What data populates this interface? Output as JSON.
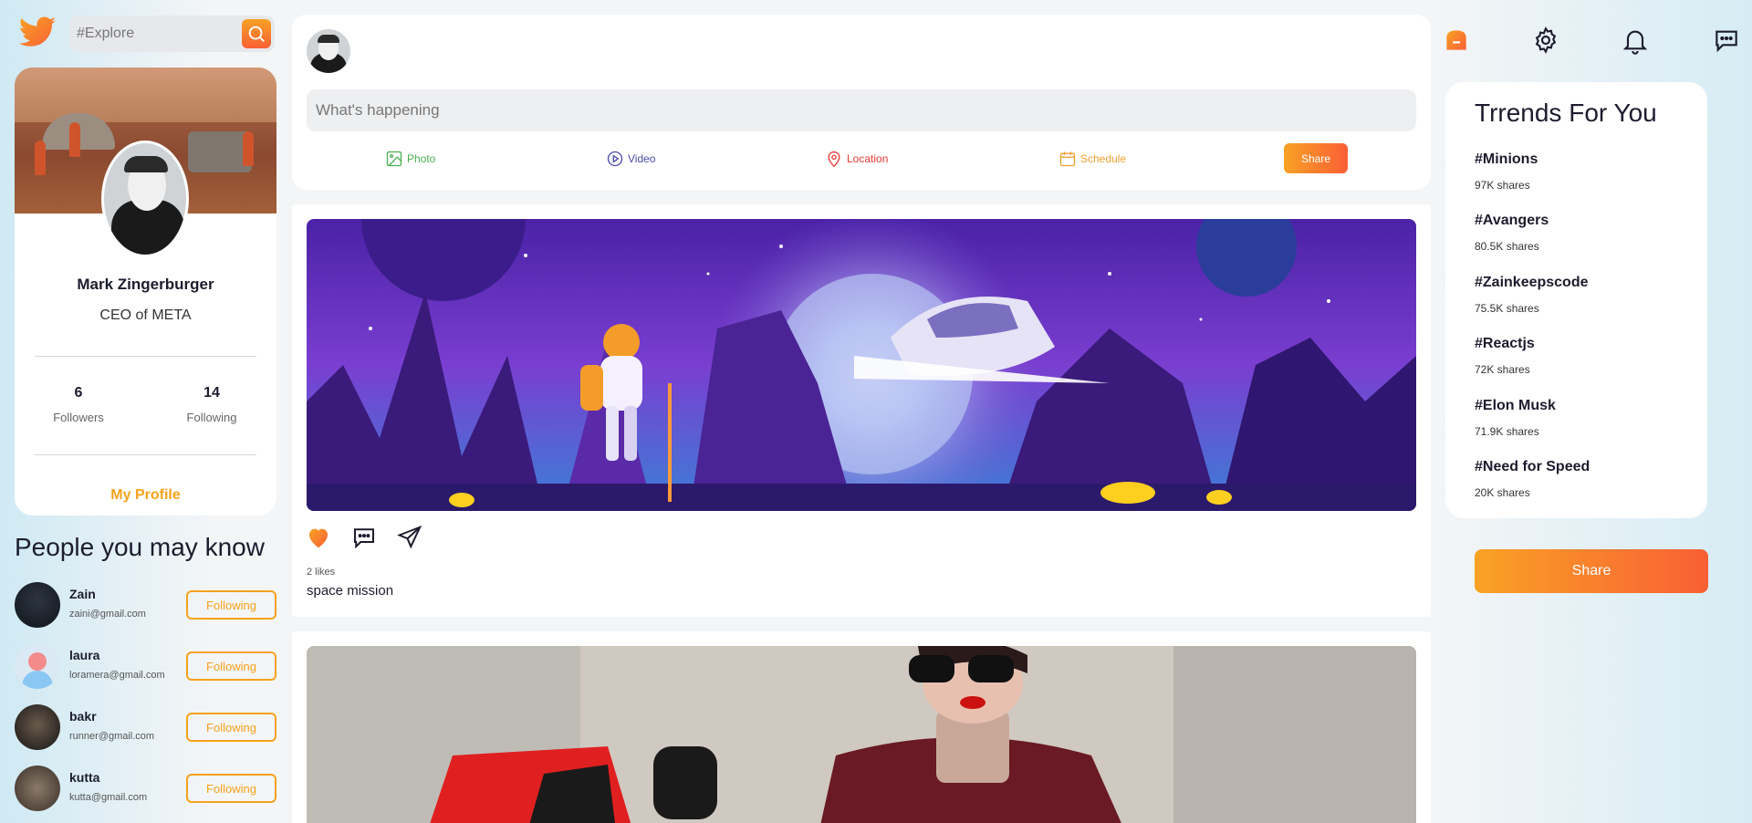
{
  "search": {
    "placeholder": "#Explore"
  },
  "profile": {
    "name": "Mark Zingerburger",
    "role": "CEO of META",
    "followers_count": "6",
    "followers_label": "Followers",
    "following_count": "14",
    "following_label": "Following",
    "link": "My Profile"
  },
  "people": {
    "title": "People you may know",
    "items": [
      {
        "name": "Zain",
        "email": "zaini@gmail.com",
        "button": "Following"
      },
      {
        "name": "laura",
        "email": "loramera@gmail.com",
        "button": "Following"
      },
      {
        "name": "bakr",
        "email": "runner@gmail.com",
        "button": "Following"
      },
      {
        "name": "kutta",
        "email": "kutta@gmail.com",
        "button": "Following"
      }
    ]
  },
  "composer": {
    "placeholder": "What's happening",
    "options": [
      {
        "label": "Photo",
        "icon": "photo-icon",
        "color": "#4caf50"
      },
      {
        "label": "Video",
        "icon": "video-icon",
        "color": "#4a4aa8"
      },
      {
        "label": "Location",
        "icon": "location-icon",
        "color": "#e53935"
      },
      {
        "label": "Schedule",
        "icon": "calendar-icon",
        "color": "#f0a030"
      }
    ],
    "share": "Share"
  },
  "posts": [
    {
      "likes": "2 likes",
      "caption": "space mission"
    }
  ],
  "trends": {
    "title": "Trrends For You",
    "items": [
      {
        "tag": "#Minions",
        "shares": "97K shares"
      },
      {
        "tag": "#Avangers",
        "shares": "80.5K shares"
      },
      {
        "tag": "#Zainkeepscode",
        "shares": "75.5K shares"
      },
      {
        "tag": "#Reactjs",
        "shares": "72K shares"
      },
      {
        "tag": "#Elon Musk",
        "shares": "71.9K shares"
      },
      {
        "tag": "#Need for Speed",
        "shares": "20K shares"
      }
    ]
  },
  "share_button": "Share",
  "colors": {
    "accent": "#f5a21d",
    "accent_end": "#f95f35"
  }
}
